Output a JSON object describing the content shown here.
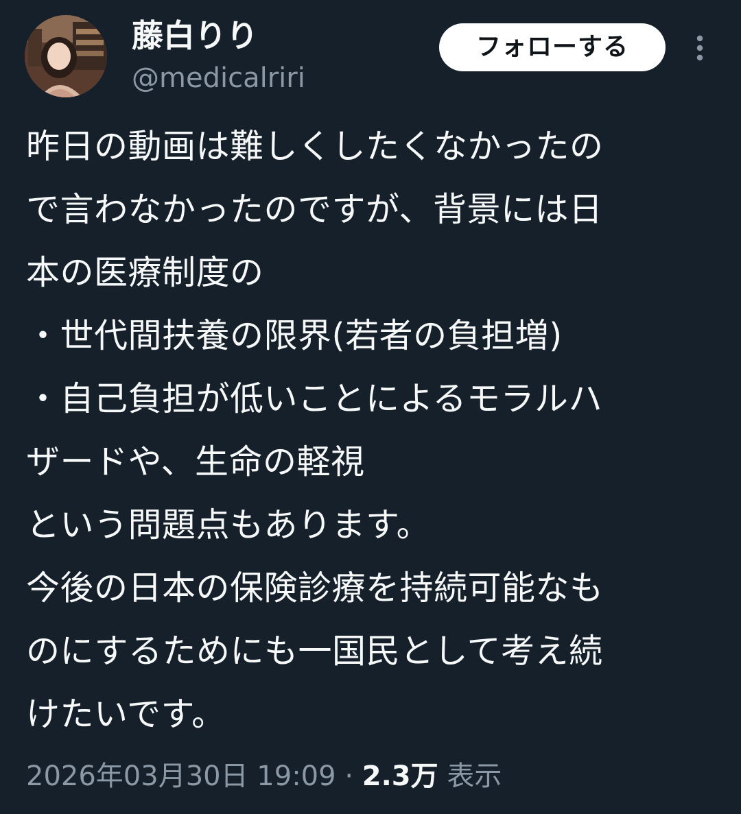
{
  "user": {
    "display_name": "藤白りり",
    "handle": "@medicalriri"
  },
  "actions": {
    "follow_label": "フォローする",
    "more_icon": "more-vertical-icon"
  },
  "tweet": {
    "lines": [
      "昨日の動画は難しくしたくなかったの",
      "で言わなかったのですが、背景には日",
      "本の医療制度の",
      "・世代間扶養の限界(若者の負担増)",
      "・自己負担が低いことによるモラルハ",
      "ザードや、生命の軽視",
      "という問題点もあります。",
      "今後の日本の保険診療を持続可能なも",
      "のにするためにも一国民として考え続",
      "けたいです。"
    ]
  },
  "meta": {
    "timestamp": "2026年03月30日 19:09",
    "separator": "·",
    "views_count": "2.3万",
    "views_label": "表示"
  },
  "colors": {
    "background": "#15202b",
    "text_primary": "#f7f9f9",
    "text_secondary": "#8b98a5",
    "button_bg": "#ffffff",
    "button_text": "#0f1419"
  }
}
